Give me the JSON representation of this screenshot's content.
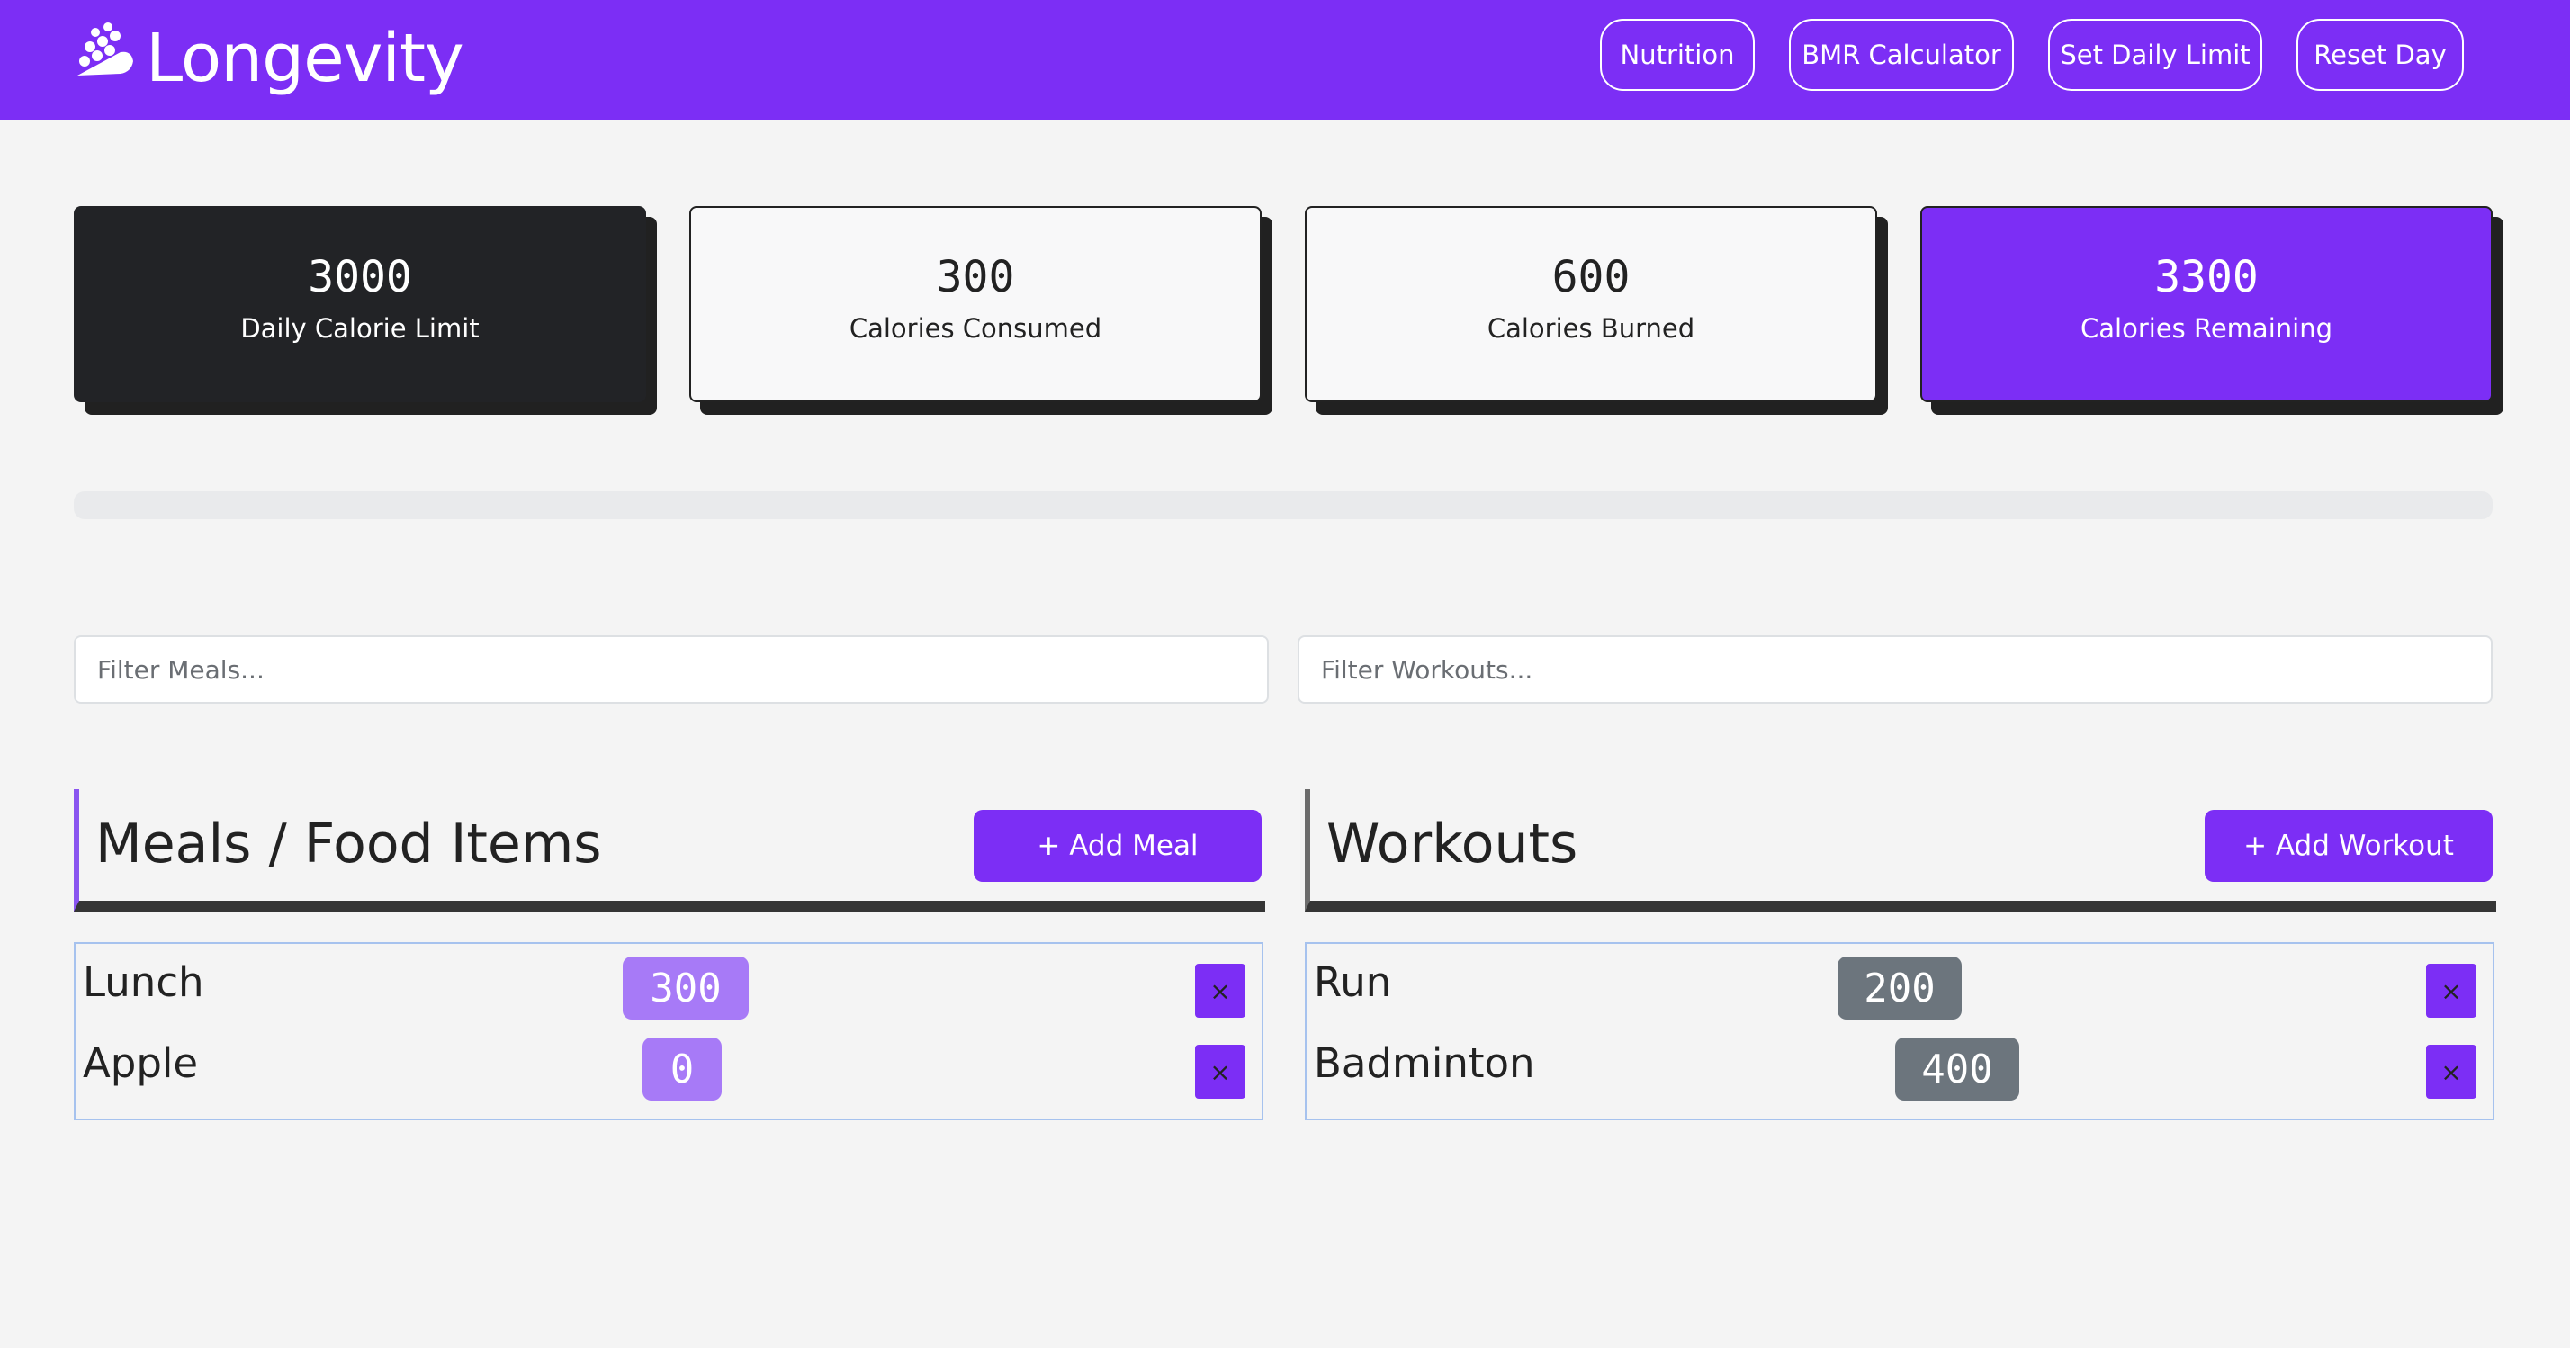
{
  "app": {
    "brand": "Longevity",
    "nav": [
      "Nutrition",
      "BMR Calculator",
      "Set Daily Limit",
      "Reset Day"
    ]
  },
  "stats": [
    {
      "value": "3000",
      "label": "Daily Calorie Limit"
    },
    {
      "value": "300",
      "label": "Calories Consumed"
    },
    {
      "value": "600",
      "label": "Calories Burned"
    },
    {
      "value": "3300",
      "label": "Calories Remaining"
    }
  ],
  "progress": {
    "percent": 0
  },
  "filters": {
    "meals_placeholder": "Filter Meals...",
    "workouts_placeholder": "Filter Workouts..."
  },
  "meals": {
    "title": "Meals / Food Items",
    "add_label": "+ Add Meal",
    "items": [
      {
        "name": "Lunch",
        "calories": "300"
      },
      {
        "name": "Apple",
        "calories": "0"
      }
    ]
  },
  "workouts": {
    "title": "Workouts",
    "add_label": "+ Add Workout",
    "items": [
      {
        "name": "Run",
        "calories": "200"
      },
      {
        "name": "Badminton",
        "calories": "400"
      }
    ]
  },
  "delete_glyph": "×",
  "colors": {
    "brand": "#7c2ef5",
    "dark": "#222326",
    "badge_meal": "#a77af7",
    "badge_workout": "#6c757d"
  }
}
